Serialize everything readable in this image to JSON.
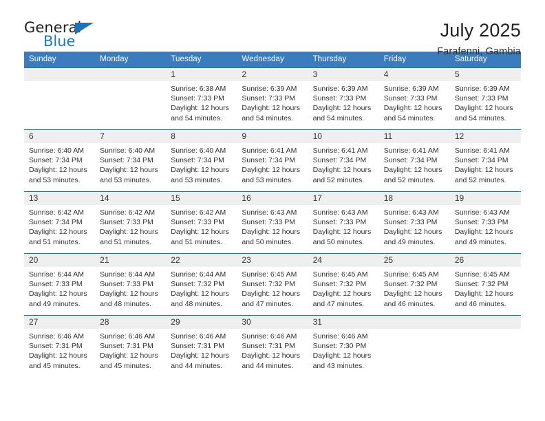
{
  "brand": {
    "name_part1": "General",
    "name_part2": "Blue",
    "triangle_color": "#1c72bd",
    "accent_color": "#2176bd"
  },
  "header": {
    "title": "July 2025",
    "subtitle": "Farafenni, Gambia"
  },
  "theme": {
    "header_blue": "#3a7cbe",
    "row_divider_blue": "#2e6da4",
    "daynum_band": "#efefef"
  },
  "calendar": {
    "weekday_headers": [
      "Sunday",
      "Monday",
      "Tuesday",
      "Wednesday",
      "Thursday",
      "Friday",
      "Saturday"
    ],
    "labels": {
      "sunrise": "Sunrise:",
      "sunset": "Sunset:",
      "daylight": "Daylight:"
    },
    "weeks": [
      [
        {
          "day": "",
          "sunrise": "",
          "sunset": "",
          "daylight_line1": "",
          "daylight_line2": ""
        },
        {
          "day": "",
          "sunrise": "",
          "sunset": "",
          "daylight_line1": "",
          "daylight_line2": ""
        },
        {
          "day": "1",
          "sunrise": "Sunrise: 6:38 AM",
          "sunset": "Sunset: 7:33 PM",
          "daylight_line1": "Daylight: 12 hours",
          "daylight_line2": "and 54 minutes."
        },
        {
          "day": "2",
          "sunrise": "Sunrise: 6:39 AM",
          "sunset": "Sunset: 7:33 PM",
          "daylight_line1": "Daylight: 12 hours",
          "daylight_line2": "and 54 minutes."
        },
        {
          "day": "3",
          "sunrise": "Sunrise: 6:39 AM",
          "sunset": "Sunset: 7:33 PM",
          "daylight_line1": "Daylight: 12 hours",
          "daylight_line2": "and 54 minutes."
        },
        {
          "day": "4",
          "sunrise": "Sunrise: 6:39 AM",
          "sunset": "Sunset: 7:33 PM",
          "daylight_line1": "Daylight: 12 hours",
          "daylight_line2": "and 54 minutes."
        },
        {
          "day": "5",
          "sunrise": "Sunrise: 6:39 AM",
          "sunset": "Sunset: 7:33 PM",
          "daylight_line1": "Daylight: 12 hours",
          "daylight_line2": "and 54 minutes."
        }
      ],
      [
        {
          "day": "6",
          "sunrise": "Sunrise: 6:40 AM",
          "sunset": "Sunset: 7:34 PM",
          "daylight_line1": "Daylight: 12 hours",
          "daylight_line2": "and 53 minutes."
        },
        {
          "day": "7",
          "sunrise": "Sunrise: 6:40 AM",
          "sunset": "Sunset: 7:34 PM",
          "daylight_line1": "Daylight: 12 hours",
          "daylight_line2": "and 53 minutes."
        },
        {
          "day": "8",
          "sunrise": "Sunrise: 6:40 AM",
          "sunset": "Sunset: 7:34 PM",
          "daylight_line1": "Daylight: 12 hours",
          "daylight_line2": "and 53 minutes."
        },
        {
          "day": "9",
          "sunrise": "Sunrise: 6:41 AM",
          "sunset": "Sunset: 7:34 PM",
          "daylight_line1": "Daylight: 12 hours",
          "daylight_line2": "and 53 minutes."
        },
        {
          "day": "10",
          "sunrise": "Sunrise: 6:41 AM",
          "sunset": "Sunset: 7:34 PM",
          "daylight_line1": "Daylight: 12 hours",
          "daylight_line2": "and 52 minutes."
        },
        {
          "day": "11",
          "sunrise": "Sunrise: 6:41 AM",
          "sunset": "Sunset: 7:34 PM",
          "daylight_line1": "Daylight: 12 hours",
          "daylight_line2": "and 52 minutes."
        },
        {
          "day": "12",
          "sunrise": "Sunrise: 6:41 AM",
          "sunset": "Sunset: 7:34 PM",
          "daylight_line1": "Daylight: 12 hours",
          "daylight_line2": "and 52 minutes."
        }
      ],
      [
        {
          "day": "13",
          "sunrise": "Sunrise: 6:42 AM",
          "sunset": "Sunset: 7:34 PM",
          "daylight_line1": "Daylight: 12 hours",
          "daylight_line2": "and 51 minutes."
        },
        {
          "day": "14",
          "sunrise": "Sunrise: 6:42 AM",
          "sunset": "Sunset: 7:33 PM",
          "daylight_line1": "Daylight: 12 hours",
          "daylight_line2": "and 51 minutes."
        },
        {
          "day": "15",
          "sunrise": "Sunrise: 6:42 AM",
          "sunset": "Sunset: 7:33 PM",
          "daylight_line1": "Daylight: 12 hours",
          "daylight_line2": "and 51 minutes."
        },
        {
          "day": "16",
          "sunrise": "Sunrise: 6:43 AM",
          "sunset": "Sunset: 7:33 PM",
          "daylight_line1": "Daylight: 12 hours",
          "daylight_line2": "and 50 minutes."
        },
        {
          "day": "17",
          "sunrise": "Sunrise: 6:43 AM",
          "sunset": "Sunset: 7:33 PM",
          "daylight_line1": "Daylight: 12 hours",
          "daylight_line2": "and 50 minutes."
        },
        {
          "day": "18",
          "sunrise": "Sunrise: 6:43 AM",
          "sunset": "Sunset: 7:33 PM",
          "daylight_line1": "Daylight: 12 hours",
          "daylight_line2": "and 49 minutes."
        },
        {
          "day": "19",
          "sunrise": "Sunrise: 6:43 AM",
          "sunset": "Sunset: 7:33 PM",
          "daylight_line1": "Daylight: 12 hours",
          "daylight_line2": "and 49 minutes."
        }
      ],
      [
        {
          "day": "20",
          "sunrise": "Sunrise: 6:44 AM",
          "sunset": "Sunset: 7:33 PM",
          "daylight_line1": "Daylight: 12 hours",
          "daylight_line2": "and 49 minutes."
        },
        {
          "day": "21",
          "sunrise": "Sunrise: 6:44 AM",
          "sunset": "Sunset: 7:33 PM",
          "daylight_line1": "Daylight: 12 hours",
          "daylight_line2": "and 48 minutes."
        },
        {
          "day": "22",
          "sunrise": "Sunrise: 6:44 AM",
          "sunset": "Sunset: 7:32 PM",
          "daylight_line1": "Daylight: 12 hours",
          "daylight_line2": "and 48 minutes."
        },
        {
          "day": "23",
          "sunrise": "Sunrise: 6:45 AM",
          "sunset": "Sunset: 7:32 PM",
          "daylight_line1": "Daylight: 12 hours",
          "daylight_line2": "and 47 minutes."
        },
        {
          "day": "24",
          "sunrise": "Sunrise: 6:45 AM",
          "sunset": "Sunset: 7:32 PM",
          "daylight_line1": "Daylight: 12 hours",
          "daylight_line2": "and 47 minutes."
        },
        {
          "day": "25",
          "sunrise": "Sunrise: 6:45 AM",
          "sunset": "Sunset: 7:32 PM",
          "daylight_line1": "Daylight: 12 hours",
          "daylight_line2": "and 46 minutes."
        },
        {
          "day": "26",
          "sunrise": "Sunrise: 6:45 AM",
          "sunset": "Sunset: 7:32 PM",
          "daylight_line1": "Daylight: 12 hours",
          "daylight_line2": "and 46 minutes."
        }
      ],
      [
        {
          "day": "27",
          "sunrise": "Sunrise: 6:46 AM",
          "sunset": "Sunset: 7:31 PM",
          "daylight_line1": "Daylight: 12 hours",
          "daylight_line2": "and 45 minutes."
        },
        {
          "day": "28",
          "sunrise": "Sunrise: 6:46 AM",
          "sunset": "Sunset: 7:31 PM",
          "daylight_line1": "Daylight: 12 hours",
          "daylight_line2": "and 45 minutes."
        },
        {
          "day": "29",
          "sunrise": "Sunrise: 6:46 AM",
          "sunset": "Sunset: 7:31 PM",
          "daylight_line1": "Daylight: 12 hours",
          "daylight_line2": "and 44 minutes."
        },
        {
          "day": "30",
          "sunrise": "Sunrise: 6:46 AM",
          "sunset": "Sunset: 7:31 PM",
          "daylight_line1": "Daylight: 12 hours",
          "daylight_line2": "and 44 minutes."
        },
        {
          "day": "31",
          "sunrise": "Sunrise: 6:46 AM",
          "sunset": "Sunset: 7:30 PM",
          "daylight_line1": "Daylight: 12 hours",
          "daylight_line2": "and 43 minutes."
        },
        {
          "day": "",
          "sunrise": "",
          "sunset": "",
          "daylight_line1": "",
          "daylight_line2": ""
        },
        {
          "day": "",
          "sunrise": "",
          "sunset": "",
          "daylight_line1": "",
          "daylight_line2": ""
        }
      ]
    ]
  }
}
